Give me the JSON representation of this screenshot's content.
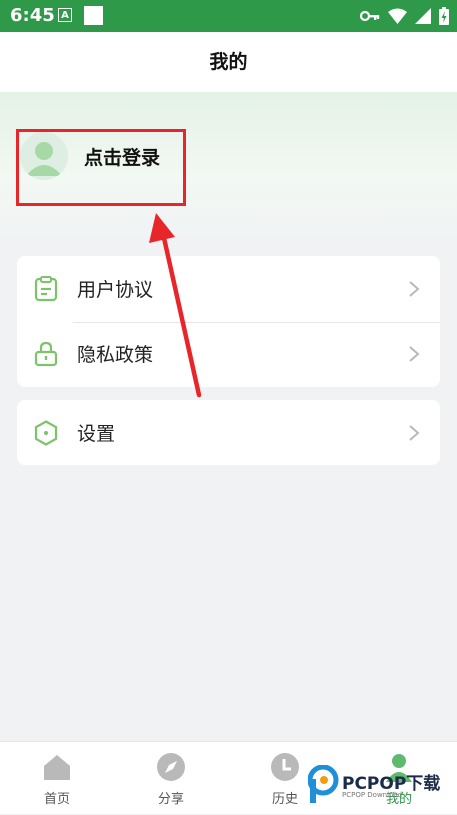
{
  "status_bar": {
    "time": "6:45",
    "notif_letter": "A",
    "icons": [
      "key-icon",
      "wifi-icon",
      "signal-icon",
      "battery-icon"
    ]
  },
  "header": {
    "title": "我的"
  },
  "profile": {
    "login_label": "点击登录"
  },
  "menu": {
    "group1": [
      {
        "label": "用户协议",
        "icon": "clipboard-icon"
      },
      {
        "label": "隐私政策",
        "icon": "lock-icon"
      }
    ],
    "group2": [
      {
        "label": "设置",
        "icon": "hexagon-icon"
      }
    ]
  },
  "tabs": [
    {
      "label": "首页",
      "icon": "home-icon"
    },
    {
      "label": "分享",
      "icon": "compass-icon"
    },
    {
      "label": "历史",
      "icon": "clock-icon"
    },
    {
      "label": "我的",
      "icon": "user-icon",
      "active": true
    }
  ],
  "watermark": {
    "text": "PCPOP下载",
    "sub": "PCPOP Download"
  },
  "colors": {
    "status_green": "#2e9a49",
    "accent_green": "#7cc36b",
    "highlight_red": "#e8262a"
  }
}
